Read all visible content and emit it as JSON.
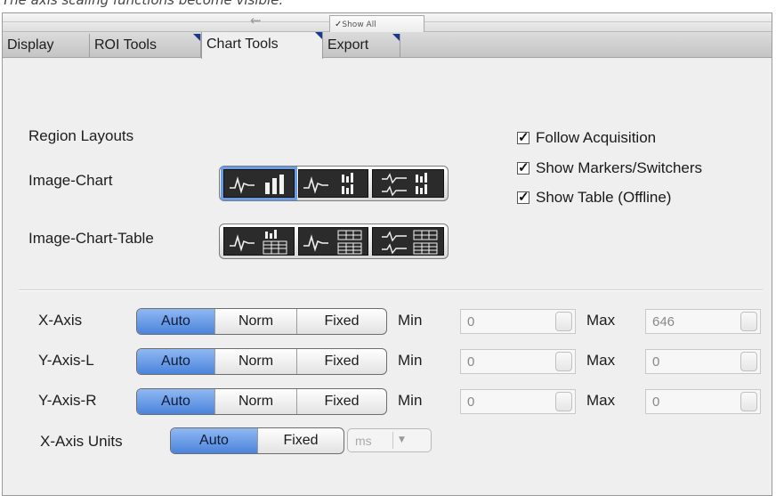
{
  "caption": "The axis scaling functions become visible.",
  "toolbar": {
    "show_all_label": "Show All"
  },
  "tabs": [
    {
      "label": "Display"
    },
    {
      "label": "ROI Tools"
    },
    {
      "label": "Chart Tools"
    },
    {
      "label": "Export"
    }
  ],
  "region_layouts": {
    "heading": "Region Layouts",
    "image_chart_label": "Image-Chart",
    "image_chart_table_label": "Image-Chart-Table"
  },
  "options": {
    "follow_acquisition": "Follow Acquisition",
    "show_markers": "Show Markers/Switchers",
    "show_table": "Show Table (Offline)"
  },
  "segment_labels": {
    "auto": "Auto",
    "norm": "Norm",
    "fixed": "Fixed"
  },
  "axes": [
    {
      "label": "X-Axis",
      "min_label": "Min",
      "min": "0",
      "max_label": "Max",
      "max": "646"
    },
    {
      "label": "Y-Axis-L",
      "min_label": "Min",
      "min": "0",
      "max_label": "Max",
      "max": "0"
    },
    {
      "label": "Y-Axis-R",
      "min_label": "Min",
      "min": "0",
      "max_label": "Max",
      "max": "0"
    }
  ],
  "x_axis_units": {
    "label": "X-Axis Units",
    "auto": "Auto",
    "fixed": "Fixed",
    "unit": "ms"
  },
  "colors": {
    "accent": "#4b84dc",
    "tab_corner": "#1c3a8c"
  }
}
